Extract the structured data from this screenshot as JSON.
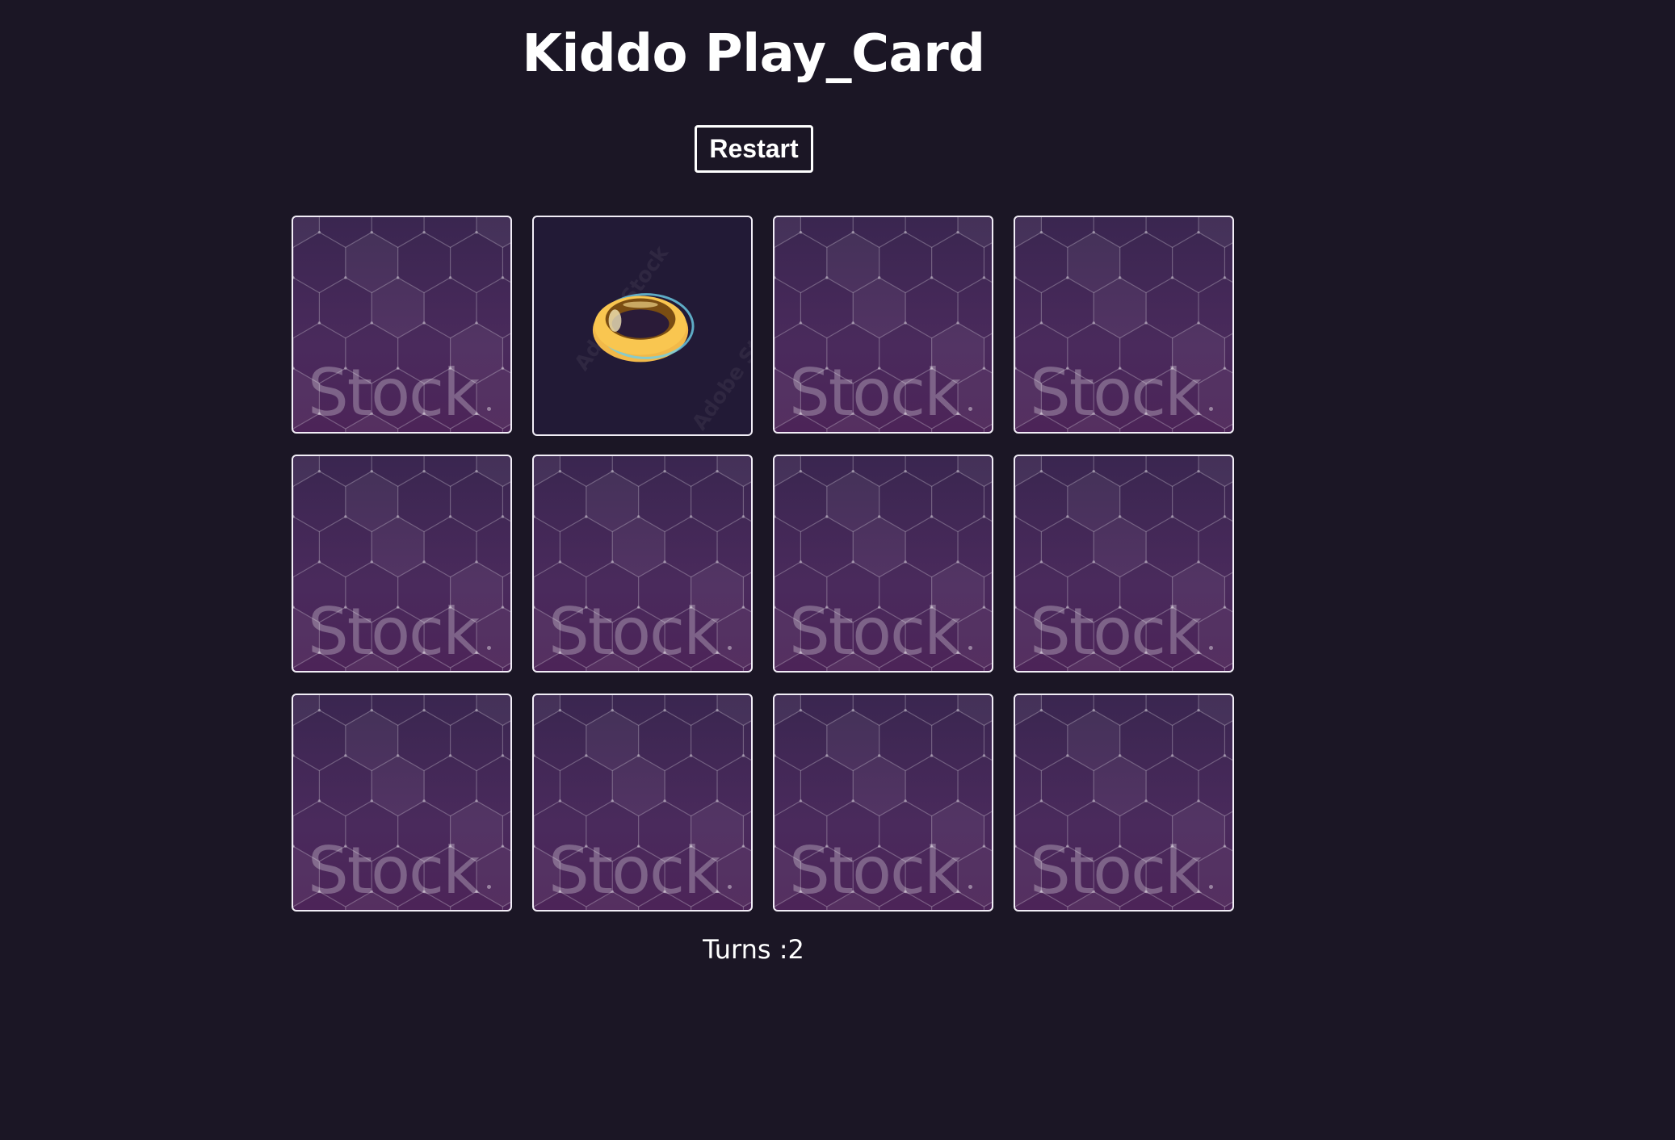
{
  "game": {
    "title": "Kiddo Play_Card",
    "restart_label": "Restart",
    "turns_label": "Turns :",
    "turns": "2"
  },
  "colors": {
    "background": "#1b1625",
    "card_border": "#f2eef7",
    "card_back": "#4a2a5c"
  },
  "cards": [
    {
      "state": "face-down",
      "watermark": "Stock"
    },
    {
      "state": "face-up",
      "image": "gold-ring-icon",
      "watermark": "Adobe Stock"
    },
    {
      "state": "face-down",
      "watermark": "Stock"
    },
    {
      "state": "face-down",
      "watermark": "Stock"
    },
    {
      "state": "face-down",
      "watermark": "Stock"
    },
    {
      "state": "face-down",
      "watermark": "Stock"
    },
    {
      "state": "face-down",
      "watermark": "Stock"
    },
    {
      "state": "face-down",
      "watermark": "Stock"
    },
    {
      "state": "face-down",
      "watermark": "Stock"
    },
    {
      "state": "face-down",
      "watermark": "Stock"
    },
    {
      "state": "face-down",
      "watermark": "Stock"
    },
    {
      "state": "face-down",
      "watermark": "Stock"
    }
  ]
}
